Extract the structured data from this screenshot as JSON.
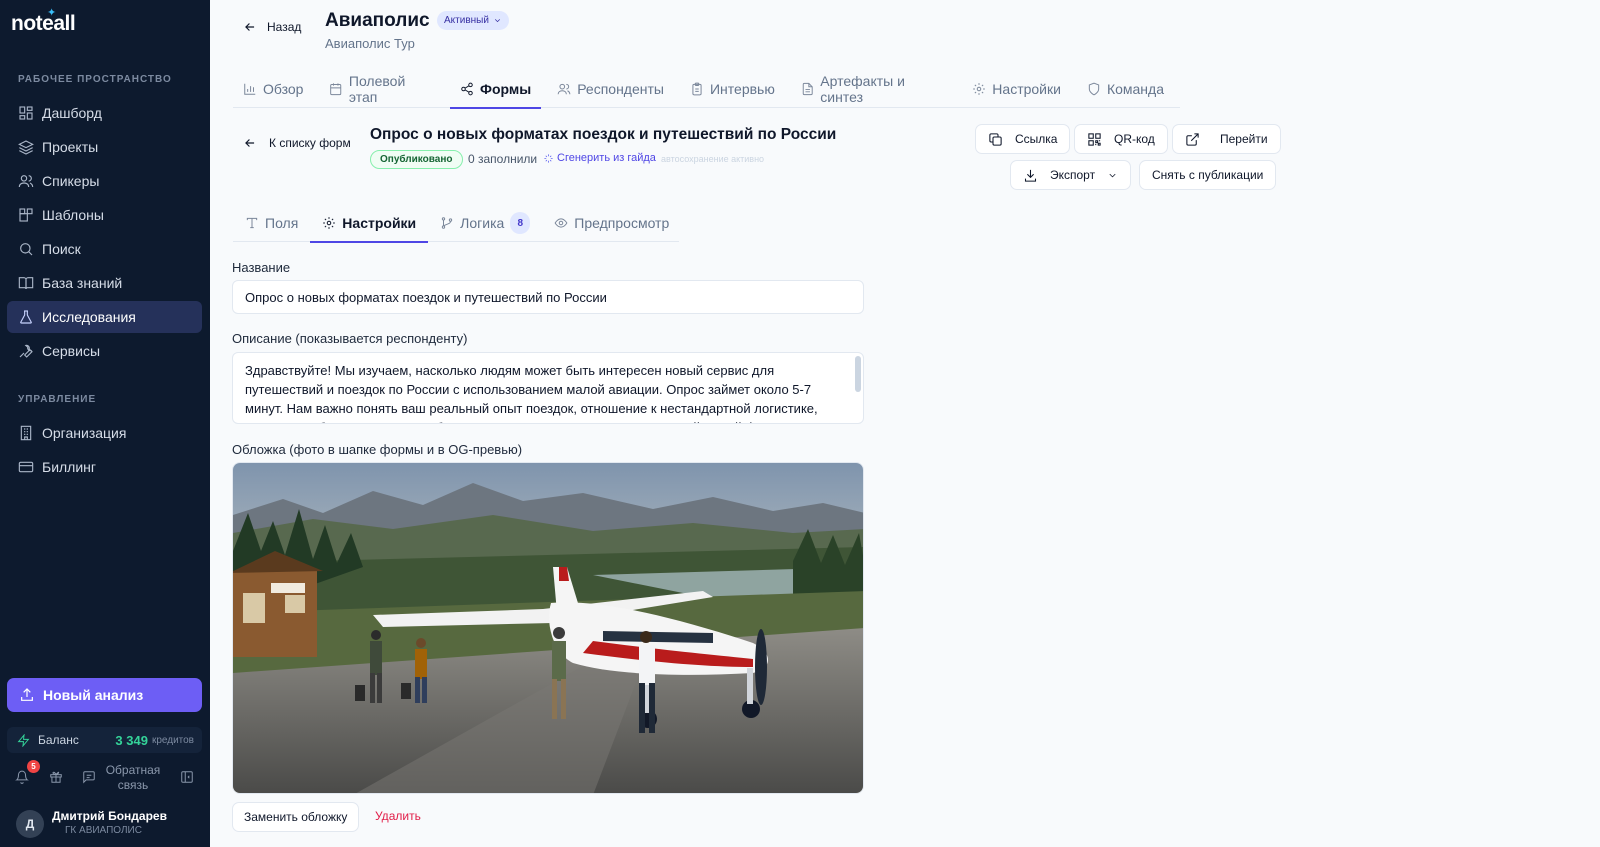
{
  "sidebar": {
    "logo": "noteall",
    "workspace_label": "РАБОЧЕЕ ПРОСТРАНСТВО",
    "workspace_items": [
      {
        "label": "Дашборд",
        "icon": "dashboard-icon"
      },
      {
        "label": "Проекты",
        "icon": "layers-icon"
      },
      {
        "label": "Спикеры",
        "icon": "users-icon"
      },
      {
        "label": "Шаблоны",
        "icon": "blocks-icon"
      },
      {
        "label": "Поиск",
        "icon": "search-icon"
      },
      {
        "label": "База знаний",
        "icon": "book-icon"
      },
      {
        "label": "Исследования",
        "icon": "flask-icon",
        "active": true
      },
      {
        "label": "Сервисы",
        "icon": "wrench-icon"
      }
    ],
    "manage_label": "УПРАВЛЕНИЕ",
    "manage_items": [
      {
        "label": "Организация",
        "icon": "building-icon"
      },
      {
        "label": "Биллинг",
        "icon": "card-icon"
      }
    ],
    "new_analysis": "Новый анализ",
    "balance_label": "Баланс",
    "balance_amount": "3 349",
    "balance_unit": "кредитов",
    "notifications_count": "5",
    "feedback": "Обратная связь",
    "user_initial": "Д",
    "user_name": "Дмитрий Бондарев",
    "user_org": "ГК АВИАПОЛИС"
  },
  "header": {
    "back": "Назад",
    "title": "Авиаполис",
    "status": "Активный",
    "subtitle": "Авиаполис Тур"
  },
  "tabs": [
    {
      "label": "Обзор",
      "icon": "bar-chart-icon"
    },
    {
      "label": "Полевой этап",
      "icon": "calendar-icon"
    },
    {
      "label": "Формы",
      "icon": "share-icon",
      "active": true
    },
    {
      "label": "Респонденты",
      "icon": "users-icon"
    },
    {
      "label": "Интервью",
      "icon": "clipboard-icon"
    },
    {
      "label": "Артефакты и синтез",
      "icon": "file-icon"
    },
    {
      "label": "Настройки",
      "icon": "gear-icon"
    },
    {
      "label": "Команда",
      "icon": "shield-icon"
    }
  ],
  "form": {
    "back_to_list": "К списку форм",
    "title": "Опрос о новых форматах поездок и путешествий по России",
    "published": "Опубликовано",
    "filled": "0 заполнили",
    "generate": "Сгенерить из гайда",
    "autosave": "автосохранение активно",
    "actions": {
      "link": "Ссылка",
      "qr": "QR-код",
      "go": "Перейти",
      "export": "Экспорт",
      "unpublish": "Снять с публикации"
    }
  },
  "subtabs": [
    {
      "label": "Поля",
      "icon": "type-icon"
    },
    {
      "label": "Настройки",
      "icon": "gear-icon",
      "active": true
    },
    {
      "label": "Логика",
      "icon": "branch-icon",
      "badge": "8"
    },
    {
      "label": "Предпросмотр",
      "icon": "eye-icon"
    }
  ],
  "settings": {
    "name_label": "Название",
    "name_value": "Опрос о новых форматах поездок и путешествий по России",
    "desc_label": "Описание (показывается респонденту)",
    "desc_value": "Здравствуйте! Мы изучаем, насколько людям может быть интересен новый сервис для путешествий и поездок по России с использованием малой авиации. Опрос займет около 5-7 минут. Нам важно понять ваш реальный опыт поездок, отношение к нестандартной логистике, восприятие безопасности и удобства, а также ваши реакции на возможный новый формат.",
    "cover_label": "Обложка (фото в шапке формы и в OG-превью)",
    "replace_cover": "Заменить обложку",
    "delete": "Удалить"
  },
  "colors": {
    "accent": "#4f46e5",
    "sidebar_bg": "#0d1a2e",
    "new_button": "#6d5ef5",
    "success": "#34d399",
    "danger": "#e11d48"
  }
}
